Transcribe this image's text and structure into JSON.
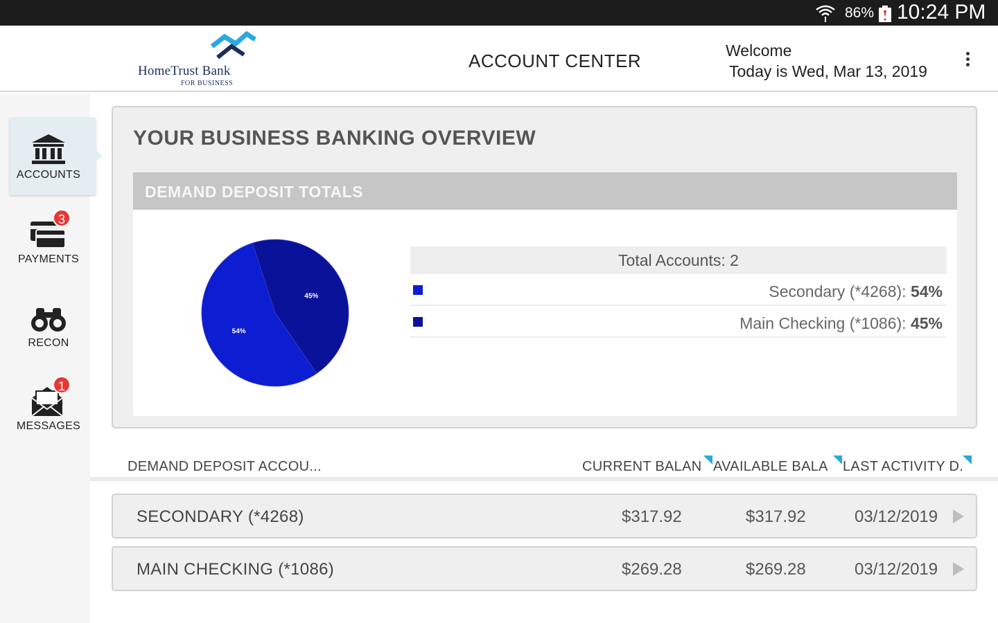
{
  "status_bar": {
    "battery": "86%",
    "time": "10:24 PM",
    "icons": [
      "wifi-icon",
      "battery-icon"
    ]
  },
  "header": {
    "logo_name": "HomeTrust Bank",
    "logo_sub": "FOR BUSINESS",
    "title": "ACCOUNT CENTER",
    "welcome": "Welcome",
    "date_line": "Today is Wed, Mar 13, 2019",
    "menu_icon": "more-vert-icon"
  },
  "sidebar": {
    "items": [
      {
        "label": "ACCOUNTS",
        "icon": "bank-icon",
        "badge": ""
      },
      {
        "label": "PAYMENTS",
        "icon": "payments-icon",
        "badge": "3"
      },
      {
        "label": "RECON",
        "icon": "binoculars-icon",
        "badge": ""
      },
      {
        "label": "MESSAGES",
        "icon": "envelope-icon",
        "badge": "1"
      }
    ]
  },
  "overview": {
    "title": "YOUR BUSINESS BANKING OVERVIEW",
    "panel_title": "DEMAND DEPOSIT TOTALS",
    "total_accounts": "Total Accounts: 2",
    "legend": [
      {
        "name": "Secondary (*4268): ",
        "pct": "54%",
        "color": "#0d1dd1"
      },
      {
        "name": "Main Checking (*1086): ",
        "pct": "45%",
        "color": "#0a129a"
      }
    ]
  },
  "chart_data": {
    "type": "pie",
    "slices": [
      {
        "label": "Secondary (*4268)",
        "value": 54,
        "display": "54%",
        "color": "#0d1dd1"
      },
      {
        "label": "Main Checking (*1086)",
        "value": 45,
        "display": "45%",
        "color": "#0a129a"
      }
    ]
  },
  "table": {
    "headers": [
      "DEMAND DEPOSIT ACCOU...",
      "CURRENT BALAN",
      "AVAILABLE BALA",
      "LAST ACTIVITY D."
    ],
    "rows": [
      {
        "name": "SECONDARY (*4268)",
        "current": "$317.92",
        "available": "$317.92",
        "last_activity": "03/12/2019"
      },
      {
        "name": "MAIN CHECKING (*1086)",
        "current": "$269.28",
        "available": "$269.28",
        "last_activity": "03/12/2019"
      }
    ]
  },
  "colors": {
    "accent": "#2aa9e0",
    "badge": "#e53935",
    "status_bar": "#1c1c1c"
  }
}
